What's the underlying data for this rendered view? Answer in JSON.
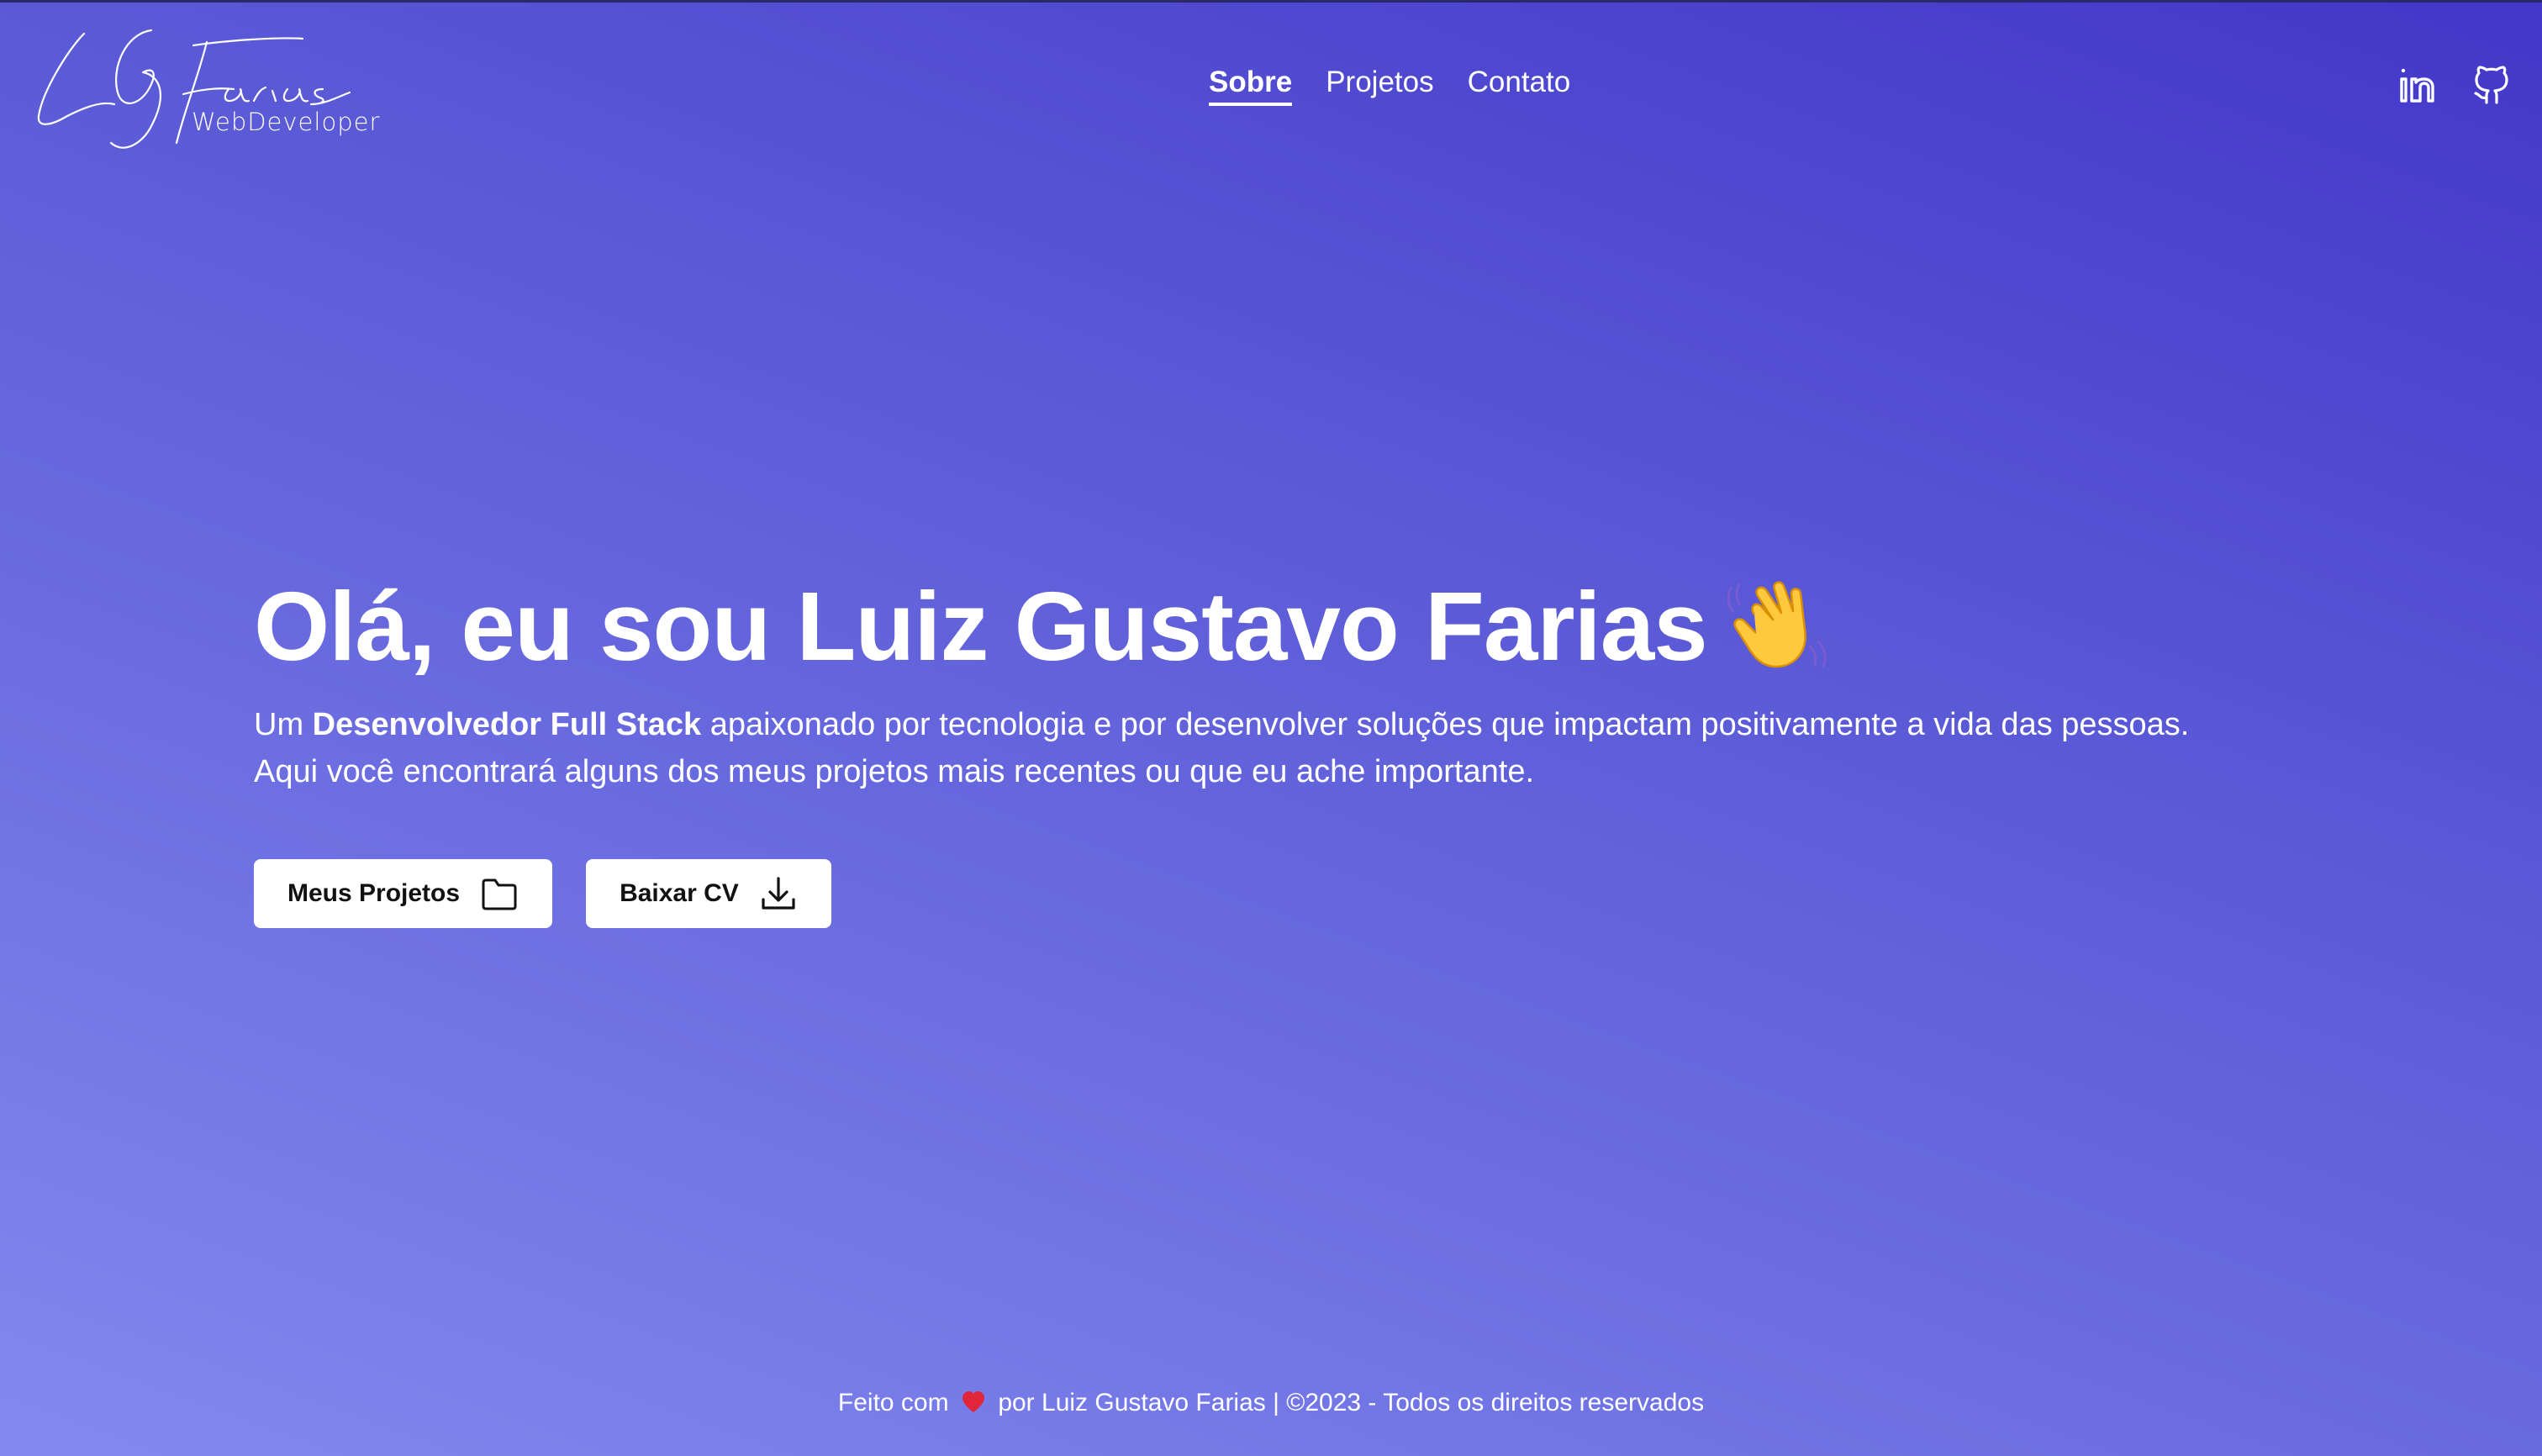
{
  "logo": {
    "signature": "LG Farias",
    "subtitle": "WebDeveloper"
  },
  "nav": {
    "items": [
      {
        "label": "Sobre",
        "active": true
      },
      {
        "label": "Projetos",
        "active": false
      },
      {
        "label": "Contato",
        "active": false
      }
    ]
  },
  "social": {
    "linkedin_icon": "linkedin-icon",
    "github_icon": "github-icon"
  },
  "hero": {
    "title": "Olá, eu sou Luiz Gustavo Farias",
    "wave_icon": "waving-hand-icon",
    "desc_prefix": "Um ",
    "desc_strong": "Desenvolvedor Full Stack",
    "desc_suffix": " apaixonado por tecnologia e por desenvolver soluções que impactam positivamente a vida das pessoas. Aqui você encontrará alguns dos meus projetos mais recentes ou que eu ache importante.",
    "buttons": {
      "projects": {
        "label": "Meus Projetos",
        "icon": "folder-icon"
      },
      "cv": {
        "label": "Baixar CV",
        "icon": "download-icon"
      }
    }
  },
  "footer": {
    "prefix": "Feito com",
    "heart_icon": "heart-icon",
    "suffix": "por Luiz Gustavo Farias | ©2023 - Todos os direitos reservados"
  },
  "colors": {
    "gradient_start": "#4336c9",
    "gradient_end": "#8189ee",
    "text": "#ffffff",
    "button_bg": "#ffffff",
    "button_text": "#111111",
    "heart": "#e0263a"
  }
}
